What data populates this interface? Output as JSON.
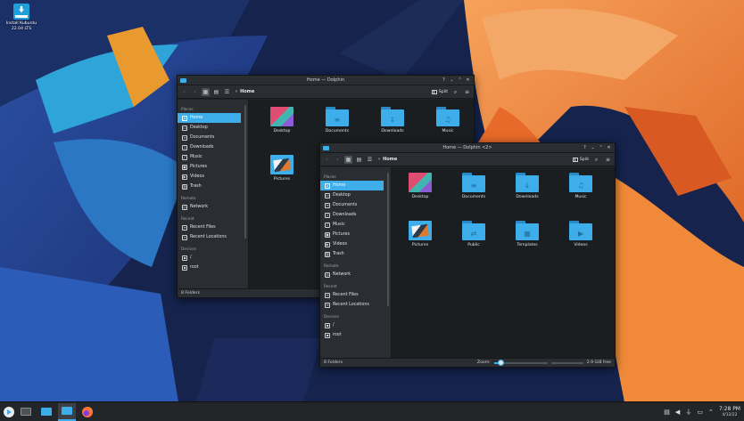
{
  "desktop": {
    "icons": [
      {
        "label_line1": "Install Kubuntu",
        "label_line2": "22.04 LTS"
      }
    ]
  },
  "windows": [
    {
      "title": "Home — Dolphin",
      "breadcrumb": "Home",
      "split_label": "Split",
      "places_header": "Places",
      "places": [
        "Home",
        "Desktop",
        "Documents",
        "Downloads",
        "Music",
        "Pictures",
        "Videos",
        "Trash"
      ],
      "remote_header": "Remote",
      "remote": [
        "Network"
      ],
      "recent_header": "Recent",
      "recent": [
        "Recent Files",
        "Recent Locations"
      ],
      "devices_header": "Devices",
      "devices": [
        "/",
        "root"
      ],
      "files": [
        {
          "name": "Desktop",
          "kind": "desktop"
        },
        {
          "name": "Documents",
          "kind": "folder",
          "glyph": "document-icon"
        },
        {
          "name": "Downloads",
          "kind": "folder",
          "glyph": "download-icon"
        },
        {
          "name": "Music",
          "kind": "folder",
          "glyph": "music-icon"
        },
        {
          "name": "Pictures",
          "kind": "pictures"
        }
      ],
      "status": "8 Folders"
    },
    {
      "title": "Home — Dolphin <2>",
      "breadcrumb": "Home",
      "split_label": "Split",
      "places_header": "Places",
      "places": [
        "Home",
        "Desktop",
        "Documents",
        "Downloads",
        "Music",
        "Pictures",
        "Videos",
        "Trash"
      ],
      "remote_header": "Remote",
      "remote": [
        "Network"
      ],
      "recent_header": "Recent",
      "recent": [
        "Recent Files",
        "Recent Locations"
      ],
      "devices_header": "Devices",
      "devices": [
        "/",
        "root"
      ],
      "files": [
        {
          "name": "Desktop",
          "kind": "desktop"
        },
        {
          "name": "Documents",
          "kind": "folder",
          "glyph": "document-icon"
        },
        {
          "name": "Downloads",
          "kind": "folder",
          "glyph": "download-icon"
        },
        {
          "name": "Music",
          "kind": "folder",
          "glyph": "music-icon"
        },
        {
          "name": "Pictures",
          "kind": "pictures"
        },
        {
          "name": "Public",
          "kind": "folder",
          "glyph": "share-icon"
        },
        {
          "name": "Templates",
          "kind": "folder",
          "glyph": "template-icon"
        },
        {
          "name": "Videos",
          "kind": "folder",
          "glyph": "video-icon"
        }
      ],
      "status": "8 Folders",
      "zoom_label": "Zoom:",
      "free_space": "2.9 GiB free"
    }
  ],
  "taskbar": {
    "clock_time": "7:28 PM",
    "clock_date": "4/12/22"
  },
  "colors": {
    "accent": "#3daee9",
    "window_bg": "#1b1e20",
    "panel_bg": "#2a2e32",
    "taskbar_bg": "#232629"
  }
}
